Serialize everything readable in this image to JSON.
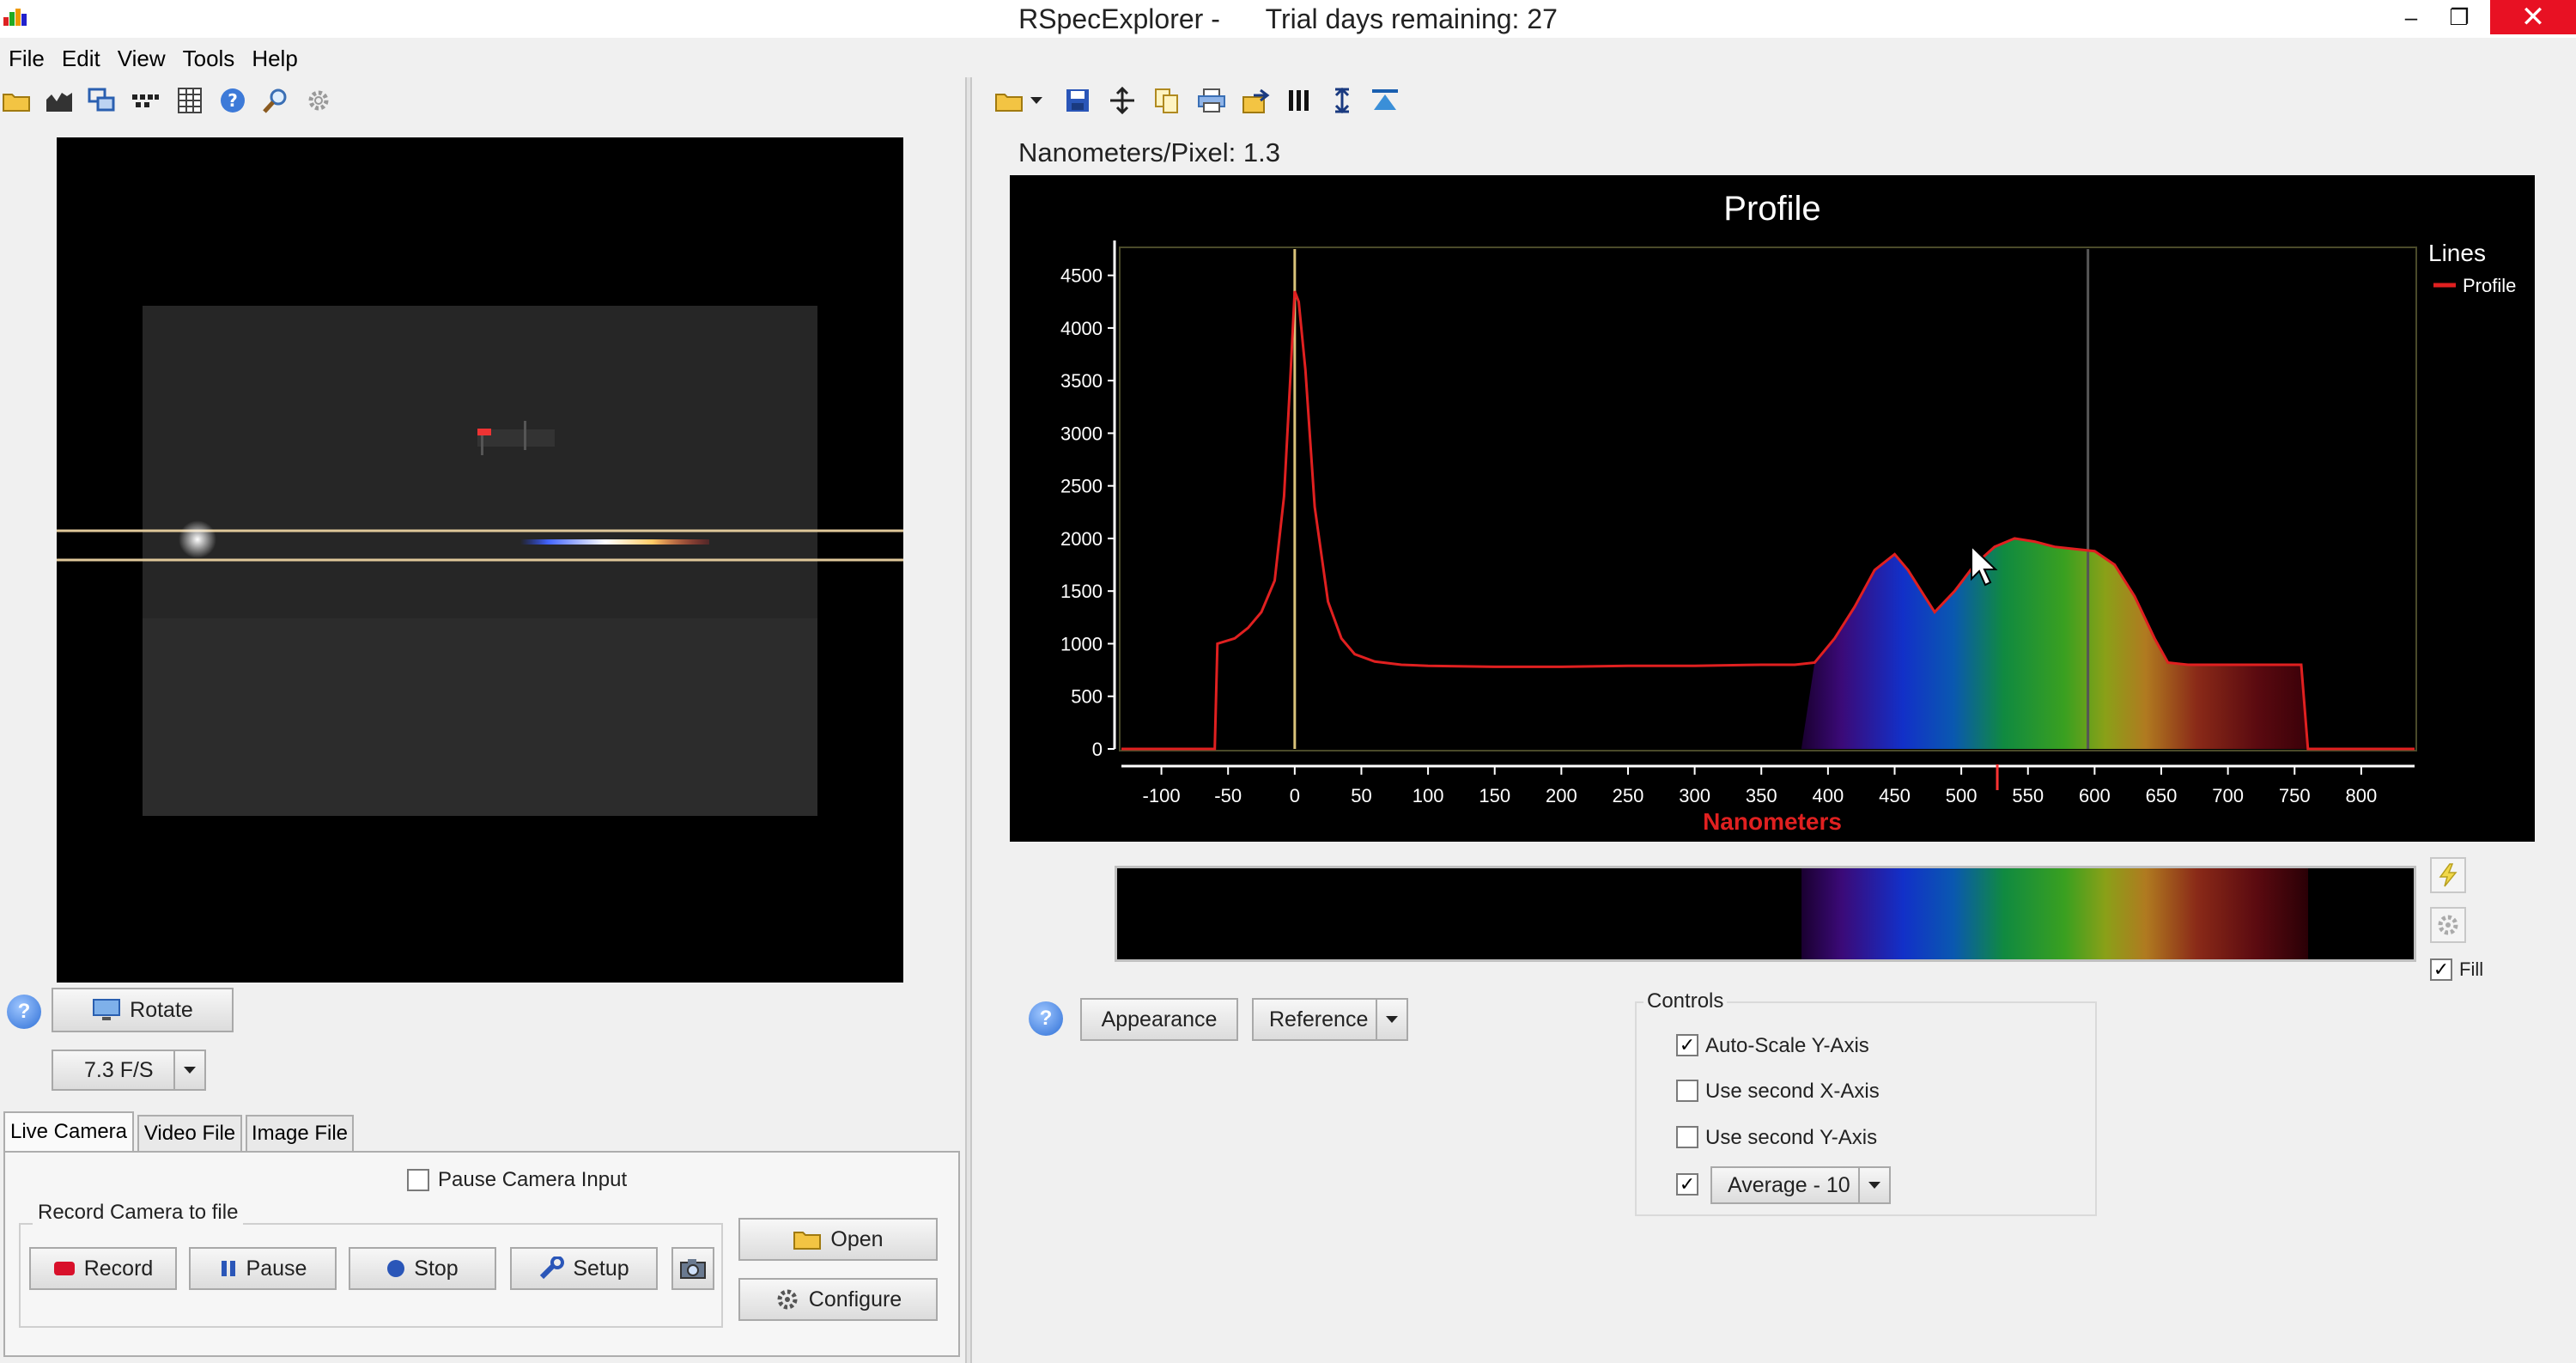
{
  "window": {
    "title": "RSpecExplorer -      Trial days remaining: 27",
    "minimize_glyph": "–",
    "restore_glyph": "❐",
    "close_glyph": "✕"
  },
  "menu": [
    "File",
    "Edit",
    "View",
    "Tools",
    "Help"
  ],
  "left_toolbar_icons": [
    "open-folder-icon",
    "chart-icon",
    "windows-icon",
    "dots-icon",
    "grid-icon",
    "help-icon",
    "zoom-icon",
    "gear-icon"
  ],
  "right_toolbar_icons": [
    "open-folder-icon",
    "dropdown-icon",
    "save-icon",
    "crosshair-icon",
    "copy-icon",
    "print-icon",
    "export-icon",
    "columns-icon",
    "vertical-arrows-icon",
    "align-top-icon"
  ],
  "camera": {
    "rotate_label": "Rotate",
    "fps_value": "7.3 F/S",
    "tabs": [
      "Live Camera",
      "Video File",
      "Image File"
    ],
    "pause_input_label": "Pause Camera Input",
    "record_group_label": "Record Camera to file",
    "buttons": {
      "record": "Record",
      "pause": "Pause",
      "stop": "Stop",
      "setup": "Setup",
      "open": "Open",
      "configure": "Configure"
    }
  },
  "nm_per_pixel": "Nanometers/Pixel: 1.3",
  "chart_data": {
    "type": "line",
    "title": "Profile",
    "xlabel": "Nanometers",
    "ylabel": "",
    "xlim": [
      -130,
      840
    ],
    "ylim": [
      0,
      4750
    ],
    "x_ticks": [
      -100,
      -50,
      0,
      50,
      100,
      150,
      200,
      250,
      300,
      350,
      400,
      450,
      500,
      550,
      600,
      650,
      700,
      750,
      800
    ],
    "y_ticks": [
      0,
      500,
      1000,
      1500,
      2000,
      2500,
      3000,
      3500,
      4000,
      4500
    ],
    "legend": {
      "title": "Lines",
      "placement": "top-right"
    },
    "series": [
      {
        "name": "Profile",
        "color": "#e02020",
        "x": [
          -130,
          -60,
          -58,
          -45,
          -35,
          -25,
          -15,
          -8,
          -3,
          0,
          3,
          8,
          15,
          25,
          35,
          45,
          60,
          80,
          100,
          150,
          200,
          250,
          300,
          350,
          375,
          390,
          405,
          420,
          435,
          450,
          460,
          470,
          480,
          495,
          510,
          525,
          540,
          555,
          570,
          585,
          600,
          615,
          630,
          645,
          655,
          670,
          700,
          730,
          755,
          760,
          765,
          840
        ],
        "y": [
          0,
          0,
          1000,
          1050,
          1150,
          1300,
          1600,
          2400,
          3600,
          4350,
          4250,
          3600,
          2300,
          1400,
          1050,
          900,
          830,
          800,
          790,
          780,
          780,
          790,
          790,
          800,
          800,
          820,
          1050,
          1350,
          1700,
          1850,
          1700,
          1500,
          1300,
          1500,
          1750,
          1920,
          2000,
          1970,
          1920,
          1900,
          1880,
          1750,
          1450,
          1050,
          820,
          800,
          800,
          800,
          800,
          0,
          0,
          0
        ]
      }
    ],
    "markers": [
      {
        "x": 0,
        "color": "#d9c27a"
      },
      {
        "x": 595,
        "color": "#555555"
      },
      {
        "x": 527,
        "color": "#ff3333"
      }
    ],
    "fill_spectrum": true,
    "grid": false
  },
  "spectrum_strip": {
    "visible_start_nm": 380,
    "visible_end_nm": 760
  },
  "side_icons": [
    "lightning-icon",
    "settings-icon"
  ],
  "fill_label": "Fill",
  "bottom_buttons": {
    "appearance": "Appearance",
    "reference": "Reference"
  },
  "controls": {
    "group_label": "Controls",
    "auto_scale": {
      "label": "Auto-Scale Y-Axis",
      "checked": true
    },
    "second_x": {
      "label": "Use second X-Axis",
      "checked": false
    },
    "second_y": {
      "label": "Use second Y-Axis",
      "checked": false
    },
    "average": {
      "value": "Average - 10",
      "checked": true
    }
  }
}
